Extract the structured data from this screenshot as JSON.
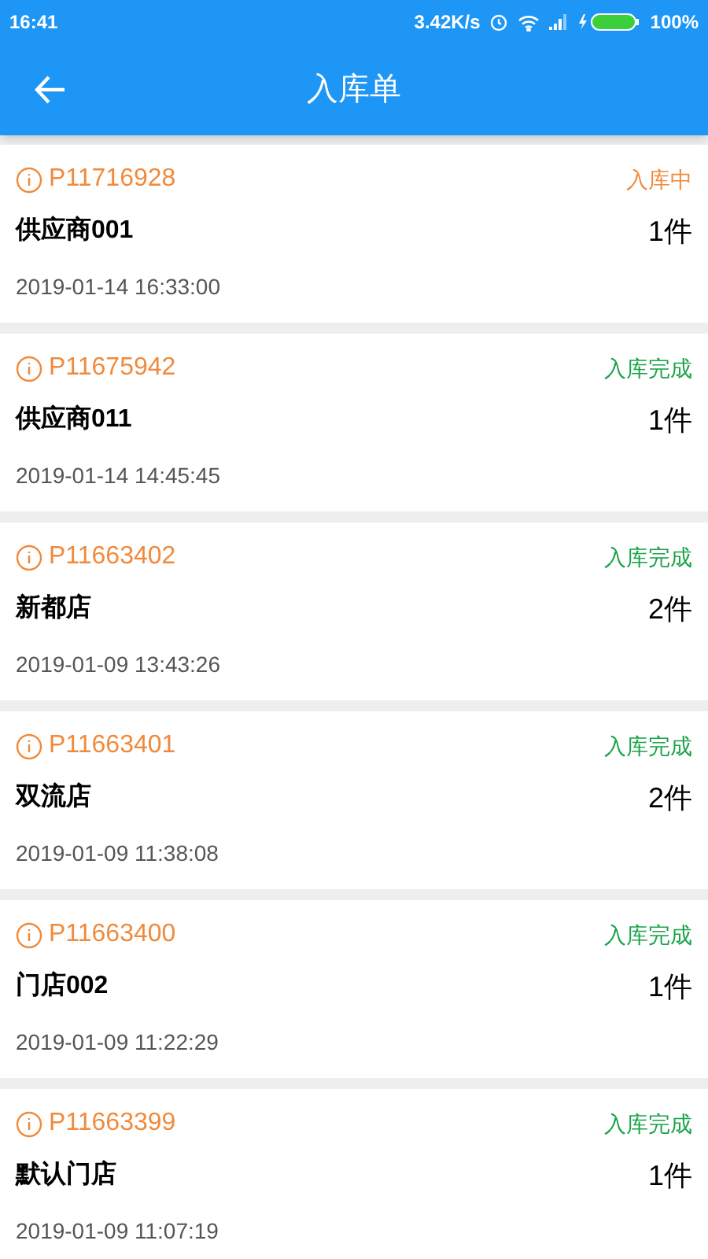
{
  "status_bar": {
    "time": "16:41",
    "speed": "3.42K/s",
    "battery": "100%"
  },
  "header": {
    "title": "入库单"
  },
  "orders": [
    {
      "id": "P11716928",
      "status": "入库中",
      "kind": "in_progress",
      "supplier": "供应商001",
      "quantity": "1件",
      "time": "2019-01-14 16:33:00"
    },
    {
      "id": "P11675942",
      "status": "入库完成",
      "kind": "done",
      "supplier": "供应商011",
      "quantity": "1件",
      "time": "2019-01-14 14:45:45"
    },
    {
      "id": "P11663402",
      "status": "入库完成",
      "kind": "done",
      "supplier": "新都店",
      "quantity": "2件",
      "time": "2019-01-09 13:43:26"
    },
    {
      "id": "P11663401",
      "status": "入库完成",
      "kind": "done",
      "supplier": "双流店",
      "quantity": "2件",
      "time": "2019-01-09 11:38:08"
    },
    {
      "id": "P11663400",
      "status": "入库完成",
      "kind": "done",
      "supplier": "门店002",
      "quantity": "1件",
      "time": "2019-01-09 11:22:29"
    },
    {
      "id": "P11663399",
      "status": "入库完成",
      "kind": "done",
      "supplier": "默认门店",
      "quantity": "1件",
      "time": "2019-01-09 11:07:19"
    }
  ]
}
